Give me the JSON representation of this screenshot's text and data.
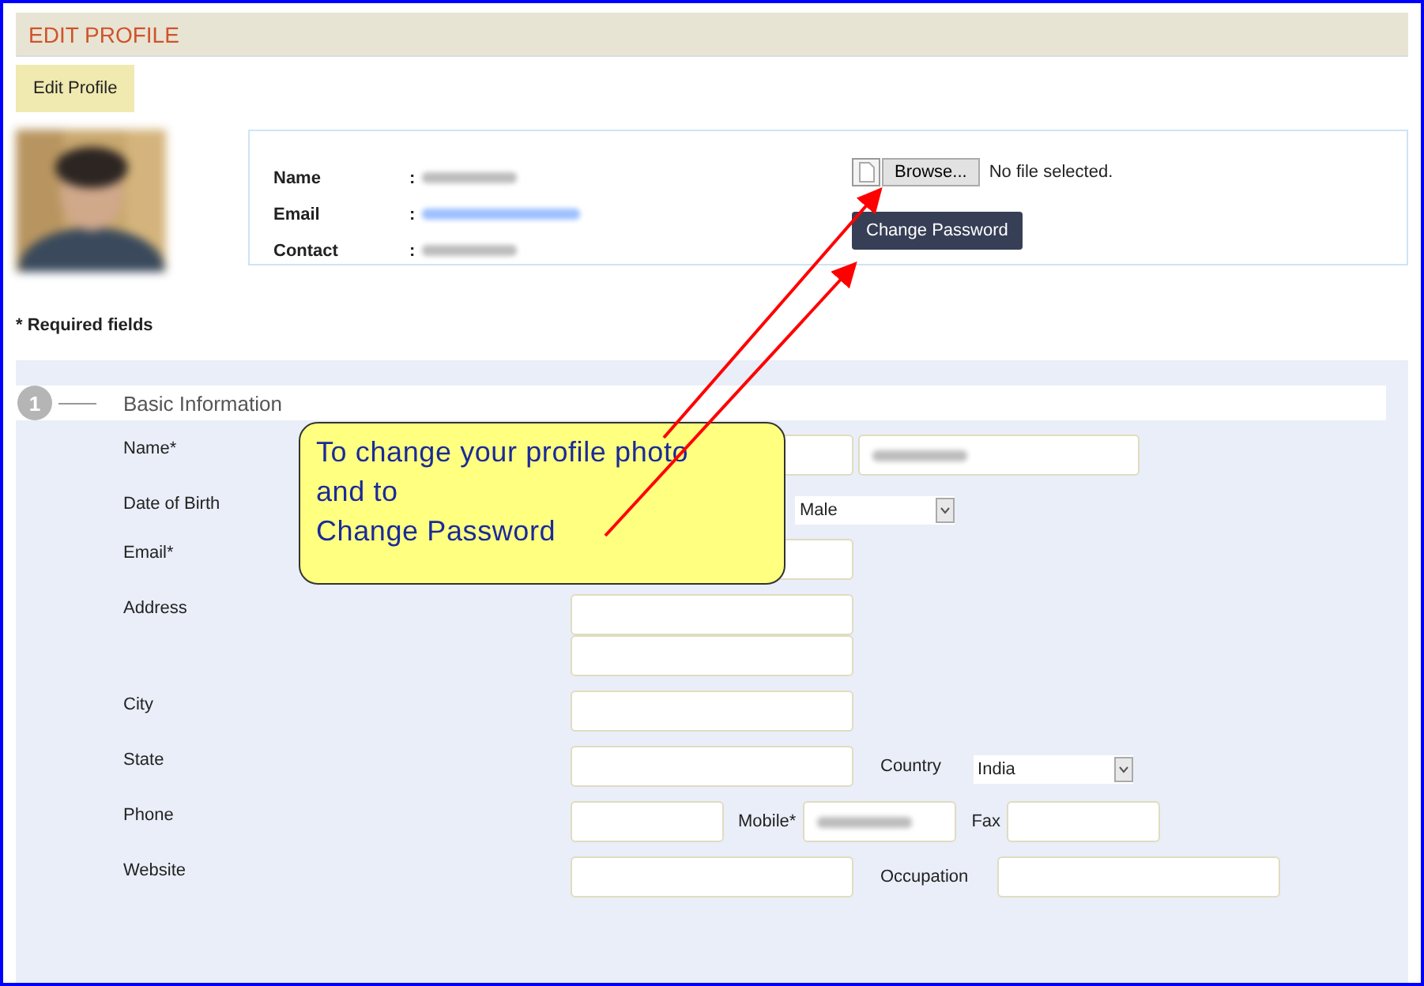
{
  "header": {
    "title": "EDIT PROFILE"
  },
  "tabs": [
    {
      "label": "Edit Profile",
      "selected": true
    }
  ],
  "profile": {
    "fields": [
      {
        "label": "Name",
        "separator": ":",
        "kind": "text"
      },
      {
        "label": "Email",
        "separator": ":",
        "kind": "link"
      },
      {
        "label": "Contact",
        "separator": ":",
        "kind": "text"
      }
    ],
    "file_input": {
      "button": "Browse...",
      "status": "No file selected."
    },
    "change_password": "Change Password"
  },
  "required_note": "* Required fields",
  "section": {
    "number": "1",
    "title": "Basic Information",
    "rows": [
      {
        "label": "Name*",
        "items": [
          {
            "kind": "input",
            "redacted": false
          },
          {
            "kind": "input",
            "redacted": true
          }
        ]
      },
      {
        "label": "Date of Birth",
        "items": [
          {
            "kind": "select",
            "value": "Male"
          }
        ]
      },
      {
        "label": "Email*",
        "items": [
          {
            "kind": "input"
          }
        ]
      },
      {
        "label": "Address",
        "items": [
          {
            "kind": "input",
            "redacted": false
          },
          {
            "kind": "input",
            "redacted": false
          }
        ]
      },
      {
        "label": "City",
        "items": [
          {
            "kind": "input",
            "redacted": false
          }
        ]
      },
      {
        "label": "State",
        "items": [
          {
            "kind": "input",
            "redacted": false
          },
          {
            "kind": "label",
            "text": "Country"
          },
          {
            "kind": "select",
            "value": "India"
          }
        ]
      },
      {
        "label": "Phone",
        "items": [
          {
            "kind": "input",
            "redacted": false
          },
          {
            "kind": "label",
            "text": "Mobile*"
          },
          {
            "kind": "input",
            "redacted": true
          },
          {
            "kind": "label",
            "text": "Fax"
          },
          {
            "kind": "input",
            "redacted": false
          }
        ]
      },
      {
        "label": "Website",
        "items": [
          {
            "kind": "input",
            "redacted": false
          },
          {
            "kind": "label",
            "text": "Occupation"
          },
          {
            "kind": "input",
            "redacted": false
          }
        ]
      }
    ]
  },
  "callout": {
    "lines": [
      "To change your profile photo",
      "and to",
      "Change Password"
    ]
  }
}
